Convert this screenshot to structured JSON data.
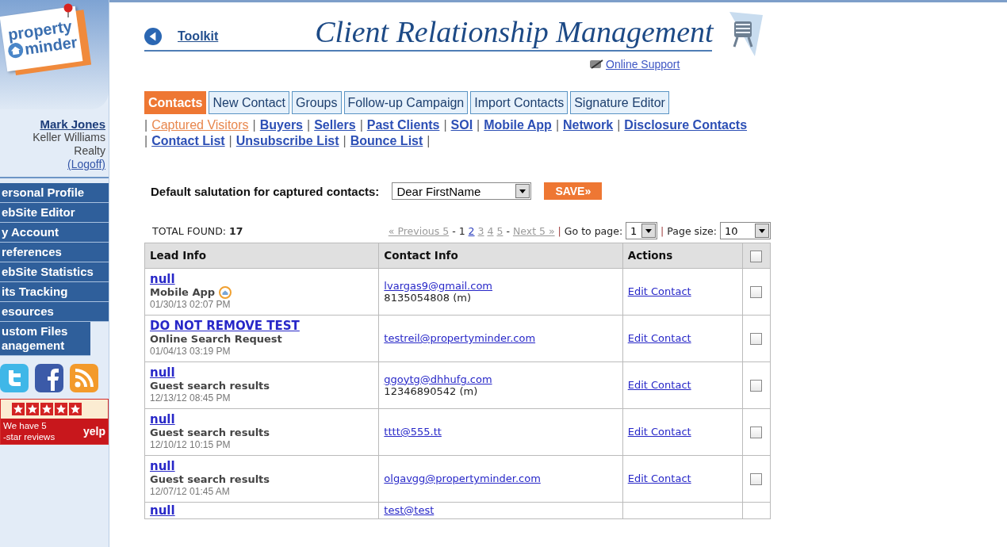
{
  "sidebar": {
    "logo": {
      "line1": "property",
      "line2": "minder"
    },
    "user": {
      "name": "Mark Jones",
      "company": "Keller Williams Realty",
      "logoff": "(Logoff)"
    },
    "nav": [
      {
        "label": "ersonal Profile"
      },
      {
        "label": "ebSite Editor"
      },
      {
        "label": "y Account"
      },
      {
        "label": "references"
      },
      {
        "label": "ebSite Statistics"
      },
      {
        "label": "its Tracking"
      },
      {
        "label": "esources"
      },
      {
        "label": "ustom Files anagement"
      }
    ],
    "review": {
      "line1": "We have 5",
      "line2": "-star reviews",
      "brand": "yelp"
    }
  },
  "header": {
    "back_link": "Toolkit",
    "title": "Client Relationship Management",
    "support_link": "Online Support"
  },
  "tabs": [
    {
      "label": "Contacts",
      "selected": true
    },
    {
      "label": "New Contact",
      "selected": false
    },
    {
      "label": "Groups",
      "selected": false
    },
    {
      "label": "Follow-up Campaign",
      "selected": false
    },
    {
      "label": "Import Contacts",
      "selected": false
    },
    {
      "label": "Signature Editor",
      "selected": false
    }
  ],
  "sub_links": {
    "divider": "|",
    "lines": [
      [
        {
          "label": "Captured Visitors",
          "selected": true
        },
        {
          "label": "Buyers",
          "selected": false
        },
        {
          "label": "Sellers",
          "selected": false
        },
        {
          "label": "Past Clients",
          "selected": false
        },
        {
          "label": "SOI",
          "selected": false
        },
        {
          "label": "Mobile App",
          "selected": false
        },
        {
          "label": "Network",
          "selected": false
        },
        {
          "label": "Disclosure Contacts",
          "selected": false
        }
      ],
      [
        {
          "label": "Contact List",
          "selected": false
        },
        {
          "label": "Unsubscribe List",
          "selected": false
        },
        {
          "label": "Bounce List",
          "selected": false
        }
      ]
    ]
  },
  "salutation": {
    "label": "Default salutation for captured contacts:",
    "value": "Dear FirstName",
    "save": "SAVE»"
  },
  "pager": {
    "total_label": "TOTAL FOUND:",
    "total": "17",
    "previous": "« Previous 5",
    "dash": "-",
    "pages": [
      {
        "label": "1",
        "selected": true
      },
      {
        "label": "2",
        "selected": false
      },
      {
        "label": "3",
        "selected": false
      },
      {
        "label": "4",
        "selected": false
      },
      {
        "label": "5",
        "selected": false
      }
    ],
    "next": "Next 5 »",
    "divider": "|",
    "goto_label": "Go to page:",
    "goto_value": "1",
    "size_label": "Page size:",
    "size_value": "10"
  },
  "table": {
    "columns": [
      "Lead Info",
      "Contact Info",
      "Actions"
    ],
    "select_all_checked": false,
    "rows": [
      {
        "name": "null",
        "source": "Mobile App",
        "app_icon": true,
        "date": "01/30/13 02:07 PM",
        "email": "lvargas9@gmail.com",
        "phone": "8135054808 (m)",
        "action": "Edit Contact",
        "checked": false
      },
      {
        "name": "DO NOT REMOVE TEST",
        "source": "Online Search Request",
        "app_icon": false,
        "date": "01/04/13 03:19 PM",
        "email": "testreil@propertyminder.com",
        "action": "Edit Contact",
        "checked": false
      },
      {
        "name": "null",
        "source": "Guest search results",
        "app_icon": false,
        "date": "12/13/12 08:45 PM",
        "email": "ggoytg@dhhufg.com",
        "phone": "12346890542 (m)",
        "action": "Edit Contact",
        "checked": false
      },
      {
        "name": "null",
        "source": "Guest search results",
        "app_icon": false,
        "date": "12/10/12 10:15 PM",
        "email": "tttt@555.tt",
        "action": "Edit Contact",
        "checked": false
      },
      {
        "name": "null",
        "source": "Guest search results",
        "app_icon": false,
        "date": "12/07/12 01:45 AM",
        "email": "olgavgg@propertyminder.com",
        "action": "Edit Contact",
        "checked": false
      },
      {
        "name": "null",
        "email": "test@test"
      }
    ]
  }
}
